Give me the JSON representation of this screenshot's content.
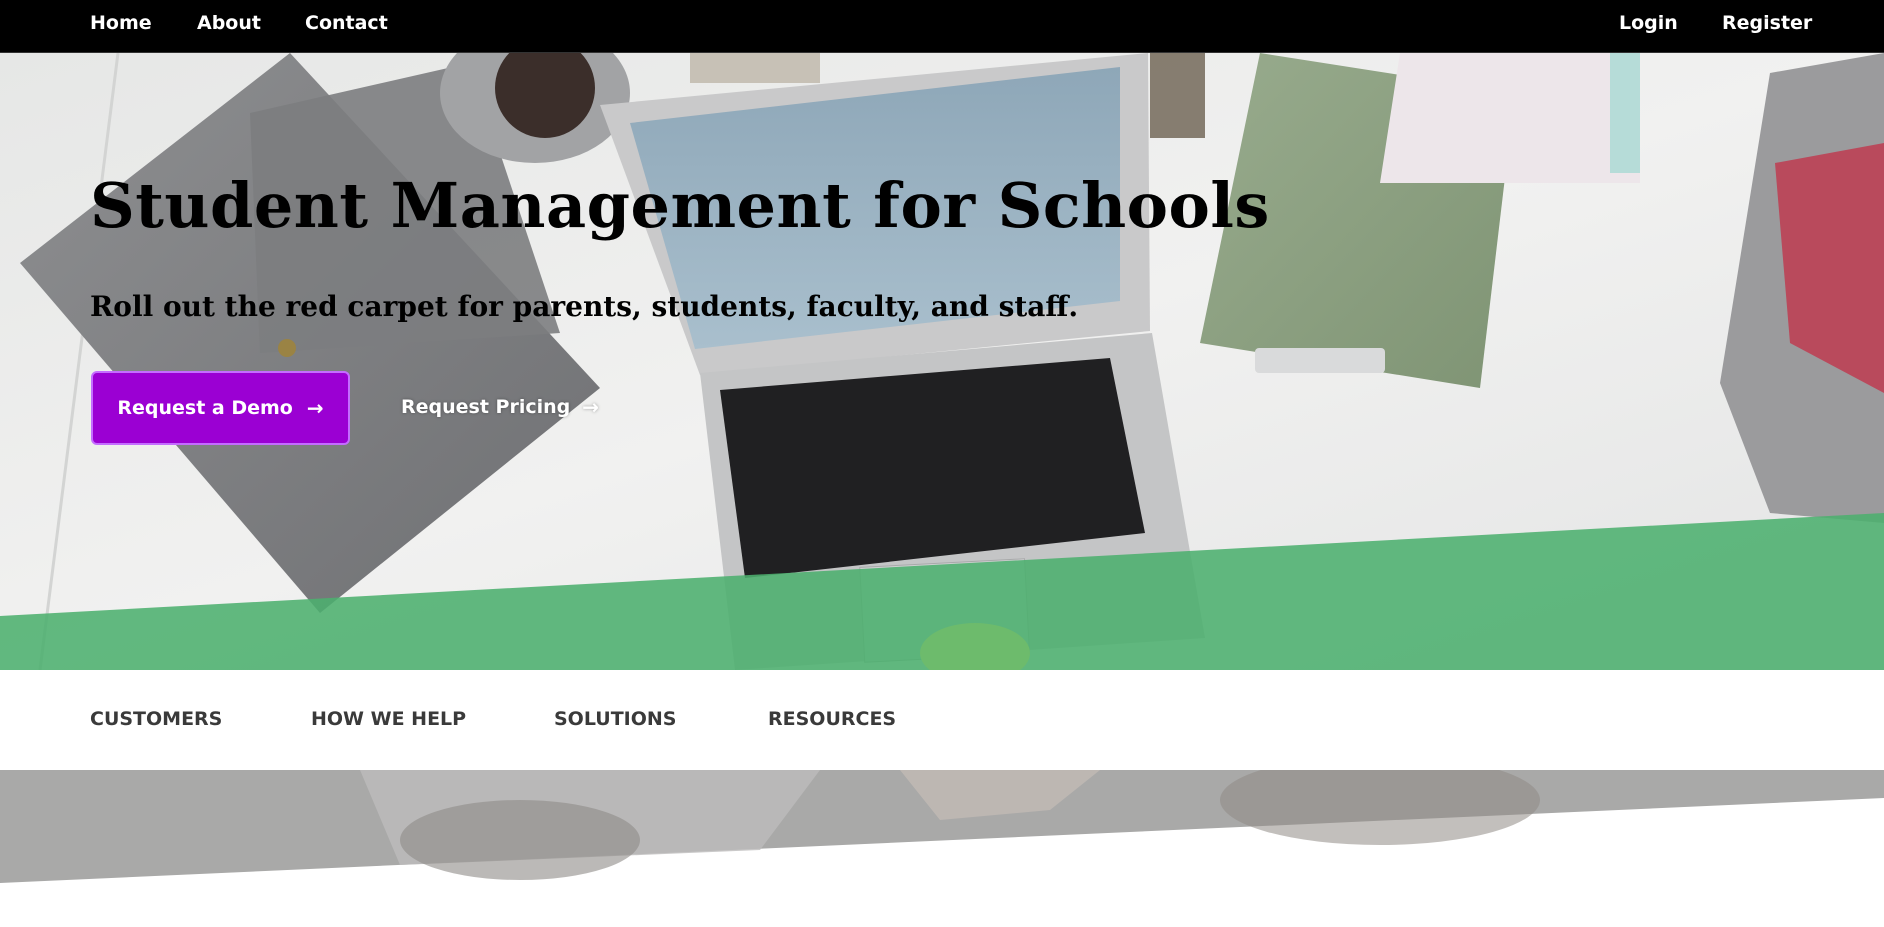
{
  "topnav": {
    "left_links": [
      "Home",
      "About",
      "Contact"
    ],
    "right_links": [
      "Login",
      "Register"
    ]
  },
  "hero": {
    "title": "Student Management for Schools",
    "subtitle": "Roll out the red carpet for parents, students, faculty, and staff.",
    "primary_cta": "Request a Demo",
    "secondary_cta": "Request Pricing",
    "arrow_icon": "arrow-right-icon"
  },
  "subnav": {
    "items": [
      "CUSTOMERS",
      "HOW WE HELP",
      "SOLUTIONS",
      "RESOURCES"
    ]
  },
  "colors": {
    "nav_bg": "#000000",
    "cta_purple": "#9b00d3",
    "band_green": "#4caf6e",
    "subnav_text": "#3a3a3a"
  }
}
